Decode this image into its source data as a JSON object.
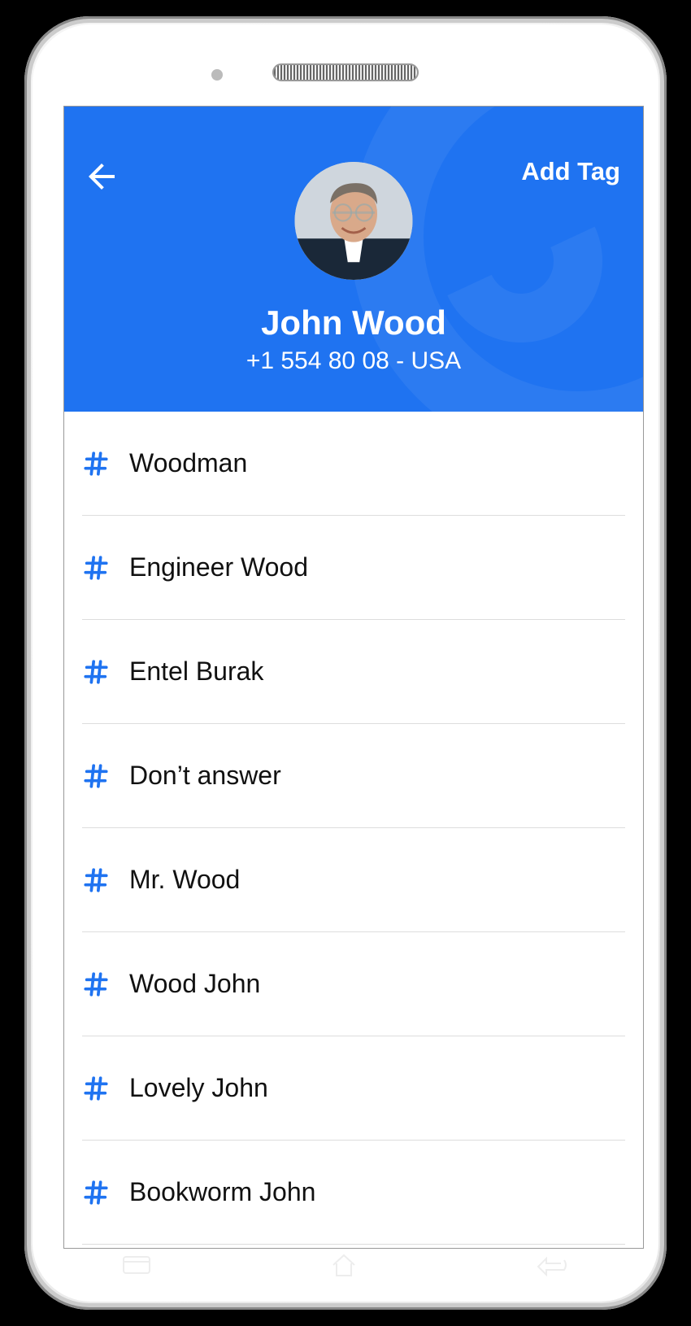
{
  "header": {
    "add_tag_label": "Add Tag"
  },
  "contact": {
    "name": "John Wood",
    "phone_line": "+1 554 80 08 - USA"
  },
  "tags": [
    {
      "label": "Woodman"
    },
    {
      "label": "Engineer Wood"
    },
    {
      "label": "Entel Burak"
    },
    {
      "label": "Don’t answer"
    },
    {
      "label": "Mr. Wood"
    },
    {
      "label": "Wood John"
    },
    {
      "label": "Lovely John"
    },
    {
      "label": "Bookworm John"
    }
  ],
  "colors": {
    "primary": "#1f73f1"
  }
}
